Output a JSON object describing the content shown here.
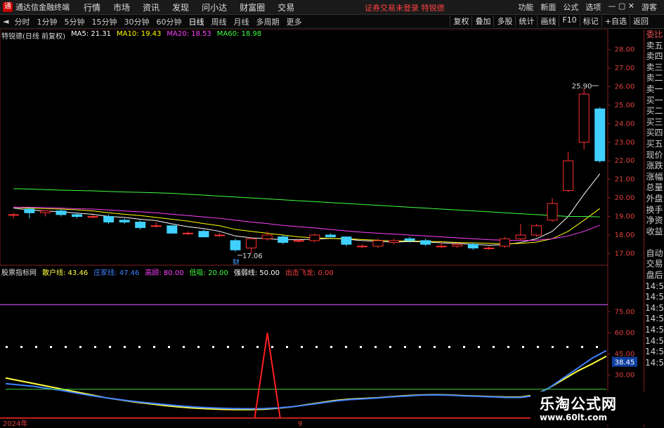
{
  "app": {
    "title": "通达信金融终端",
    "menu": [
      "行情",
      "市场",
      "资讯",
      "发现",
      "问小达",
      "财富圈",
      "交易"
    ],
    "login_warning": "证券交易未登录 特锐德",
    "right_menu": [
      "功能",
      "新面",
      "公式",
      "选项"
    ],
    "right_menu_extra": "游客"
  },
  "toolbar": {
    "periods": [
      "分时",
      "1分钟",
      "5分钟",
      "15分钟",
      "30分钟",
      "60分钟",
      "日线",
      "周线",
      "月线",
      "多周期",
      "更多"
    ],
    "active_period": "日线",
    "tools": [
      "复权",
      "叠加",
      "多股",
      "统计",
      "画线",
      "F10",
      "标记",
      "+自选",
      "返回"
    ]
  },
  "main_chart_info": {
    "stock": "特锐德(日线 前复权)",
    "ma5": "MA5: 21.31",
    "ma10": "MA10: 19.43",
    "ma20": "MA20: 18.53",
    "ma60": "MA60: 18.98",
    "colors": {
      "ma5": "#ffffff",
      "ma10": "#ffff00",
      "ma20": "#ff40ff",
      "ma60": "#40ff40"
    }
  },
  "indicator_info": {
    "name": "股票指标网",
    "items": [
      {
        "label": "散户线: 43.46",
        "color": "#ffff40"
      },
      {
        "label": "庄家线: 47.46",
        "color": "#4080ff"
      },
      {
        "label": "高顾: 80.00",
        "color": "#ff40ff"
      },
      {
        "label": "低吸: 20.00",
        "color": "#40ff40"
      },
      {
        "label": "强弱线: 50.00",
        "color": "#ffffff"
      },
      {
        "label": "出击飞龙: 0.00",
        "color": "#ff4040"
      }
    ]
  },
  "sidepanel": [
    {
      "text": "委比",
      "red": true
    },
    {
      "text": "卖五",
      "red": false
    },
    {
      "text": "卖四",
      "red": false
    },
    {
      "text": "卖三",
      "red": false
    },
    {
      "text": "卖二",
      "red": false
    },
    {
      "text": "卖一",
      "red": false
    },
    {
      "text": "买一",
      "red": false
    },
    {
      "text": "买二",
      "red": false
    },
    {
      "text": "买三",
      "red": false
    },
    {
      "text": "买四",
      "red": false
    },
    {
      "text": "买五",
      "red": false
    },
    {
      "text": "现价",
      "red": false
    },
    {
      "text": "涨跌",
      "red": false
    },
    {
      "text": "涨幅",
      "red": false
    },
    {
      "text": "总量",
      "red": false
    },
    {
      "text": "外盘",
      "red": false
    },
    {
      "text": "换手",
      "red": false
    },
    {
      "text": "净资",
      "red": false
    },
    {
      "text": "收益",
      "red": false
    },
    {
      "text": "",
      "red": false
    },
    {
      "text": "自动",
      "red": false
    },
    {
      "text": "交易",
      "red": false
    },
    {
      "text": "盘后",
      "red": false
    },
    {
      "text": "14:5",
      "red": false
    },
    {
      "text": "14:5",
      "red": false
    },
    {
      "text": "14:5",
      "red": false
    },
    {
      "text": "14:5",
      "red": false
    },
    {
      "text": "14:5",
      "red": false
    },
    {
      "text": "14:5",
      "red": false
    },
    {
      "text": "14:5",
      "red": false
    },
    {
      "text": "14:5",
      "red": false
    }
  ],
  "chart_data": [
    {
      "type": "candlestick",
      "y_ticks": [
        17.0,
        18.0,
        19.0,
        20.0,
        21.0,
        22.0,
        23.0,
        24.0,
        25.0,
        26.0,
        27.0,
        28.0
      ],
      "ylim": [
        16.6,
        28.4
      ],
      "annotations": [
        {
          "text": "25.90",
          "value": 25.9,
          "candle": 37
        },
        {
          "text": "17.06",
          "value": 17.06,
          "candle": 14
        },
        {
          "text": "财",
          "value": 16.7,
          "candle": 14
        }
      ],
      "candles": [
        [
          19.1,
          19.2,
          18.9,
          19.1
        ],
        [
          19.4,
          19.5,
          18.9,
          19.2
        ],
        [
          19.2,
          19.3,
          19.0,
          19.3
        ],
        [
          19.3,
          19.4,
          19.0,
          19.1
        ],
        [
          19.1,
          19.2,
          18.9,
          19.0
        ],
        [
          19.0,
          19.1,
          18.9,
          19.0
        ],
        [
          19.0,
          19.1,
          18.6,
          18.7
        ],
        [
          18.8,
          18.9,
          18.6,
          18.7
        ],
        [
          18.7,
          18.8,
          18.3,
          18.4
        ],
        [
          18.5,
          18.7,
          18.4,
          18.5
        ],
        [
          18.5,
          18.5,
          18.1,
          18.1
        ],
        [
          18.1,
          18.2,
          18.0,
          18.1
        ],
        [
          18.2,
          18.3,
          17.9,
          17.9
        ],
        [
          18.0,
          18.1,
          17.9,
          18.0
        ],
        [
          17.7,
          17.8,
          17.1,
          17.2
        ],
        [
          17.3,
          17.9,
          17.0,
          17.8
        ],
        [
          17.8,
          18.2,
          17.7,
          18.0
        ],
        [
          17.9,
          18.0,
          17.5,
          17.6
        ],
        [
          17.7,
          17.8,
          17.6,
          17.7
        ],
        [
          17.7,
          18.1,
          17.6,
          18.0
        ],
        [
          18.0,
          18.1,
          17.9,
          17.9
        ],
        [
          17.9,
          17.9,
          17.4,
          17.5
        ],
        [
          17.4,
          17.5,
          17.3,
          17.4
        ],
        [
          17.4,
          17.8,
          17.3,
          17.7
        ],
        [
          17.6,
          17.8,
          17.5,
          17.7
        ],
        [
          17.8,
          17.9,
          17.6,
          17.7
        ],
        [
          17.7,
          17.8,
          17.4,
          17.5
        ],
        [
          17.4,
          17.6,
          17.3,
          17.4
        ],
        [
          17.4,
          17.6,
          17.3,
          17.5
        ],
        [
          17.5,
          17.6,
          17.2,
          17.3
        ],
        [
          17.3,
          17.4,
          17.2,
          17.3
        ],
        [
          17.4,
          17.9,
          17.3,
          17.8
        ],
        [
          17.8,
          18.6,
          17.7,
          18.0
        ],
        [
          18.0,
          18.6,
          17.9,
          18.5
        ],
        [
          18.8,
          20.0,
          18.7,
          19.7
        ],
        [
          20.4,
          22.5,
          20.3,
          22.0
        ],
        [
          23.0,
          25.9,
          22.6,
          25.6
        ],
        [
          24.8,
          24.9,
          21.9,
          22.0
        ]
      ],
      "ma_series": [
        {
          "key": "ma5",
          "color": "#ffffff",
          "values": [
            19.45,
            19.35,
            19.3,
            19.25,
            19.18,
            19.12,
            19.0,
            18.95,
            18.85,
            18.78,
            18.6,
            18.45,
            18.35,
            18.2,
            17.95,
            17.85,
            17.8,
            17.75,
            17.75,
            17.78,
            17.82,
            17.78,
            17.7,
            17.66,
            17.62,
            17.65,
            17.63,
            17.58,
            17.55,
            17.5,
            17.45,
            17.48,
            17.6,
            17.8,
            18.2,
            19.0,
            20.2,
            21.3
          ]
        },
        {
          "key": "ma10",
          "color": "#ffff00",
          "values": [
            19.5,
            19.45,
            19.42,
            19.4,
            19.36,
            19.3,
            19.2,
            19.12,
            19.05,
            18.95,
            18.85,
            18.75,
            18.62,
            18.5,
            18.3,
            18.2,
            18.1,
            18.0,
            17.9,
            17.85,
            17.82,
            17.8,
            17.76,
            17.72,
            17.68,
            17.68,
            17.66,
            17.64,
            17.6,
            17.58,
            17.55,
            17.52,
            17.55,
            17.62,
            17.8,
            18.2,
            18.8,
            19.43
          ]
        },
        {
          "key": "ma20",
          "color": "#ff40ff",
          "values": [
            19.5,
            19.5,
            19.48,
            19.45,
            19.42,
            19.4,
            19.35,
            19.3,
            19.25,
            19.2,
            19.12,
            19.05,
            18.98,
            18.9,
            18.8,
            18.7,
            18.62,
            18.52,
            18.45,
            18.38,
            18.3,
            18.22,
            18.15,
            18.1,
            18.05,
            18.0,
            17.95,
            17.9,
            17.85,
            17.8,
            17.75,
            17.72,
            17.7,
            17.72,
            17.8,
            17.95,
            18.2,
            18.53
          ]
        },
        {
          "key": "ma60",
          "color": "#40ff40",
          "values": [
            20.5,
            20.48,
            20.45,
            20.42,
            20.4,
            20.38,
            20.35,
            20.32,
            20.3,
            20.28,
            20.25,
            20.2,
            20.15,
            20.1,
            20.05,
            20.0,
            19.95,
            19.9,
            19.85,
            19.8,
            19.75,
            19.7,
            19.65,
            19.6,
            19.55,
            19.5,
            19.45,
            19.4,
            19.35,
            19.3,
            19.25,
            19.2,
            19.15,
            19.1,
            19.05,
            19.0,
            19.0,
            18.98
          ]
        }
      ]
    },
    {
      "type": "line",
      "y_ticks": [
        30.0,
        45.0,
        60.0,
        75.0
      ],
      "ylim": [
        0,
        100
      ],
      "current_value_label": "38.45",
      "x_labels": [
        "2024年",
        "9"
      ],
      "series": [
        {
          "key": "retail",
          "color": "#ffff40",
          "values": [
            28,
            26,
            24,
            22,
            20,
            18,
            16,
            14,
            12.5,
            11,
            9.8,
            8.6,
            7.6,
            6.8,
            6.2,
            5.8,
            5.6,
            5.6,
            5.8,
            6.5,
            7.5,
            9,
            10.5,
            12,
            13,
            13.5,
            14,
            14.8,
            15.5,
            16,
            16.2,
            16,
            15.5,
            15.2,
            14.8,
            14.5,
            14.5,
            16,
            21,
            27,
            33,
            38,
            43.46
          ]
        },
        {
          "key": "banker",
          "color": "#4080ff",
          "values": [
            24,
            23,
            22,
            20.5,
            19,
            17.2,
            15.5,
            14,
            12.6,
            11.4,
            10.3,
            9.3,
            8.4,
            7.6,
            7,
            6.6,
            6.3,
            6.2,
            6.3,
            6.8,
            7.6,
            8.8,
            10.2,
            11.6,
            12.6,
            13.2,
            13.8,
            14.6,
            15.2,
            15.8,
            16,
            15.8,
            15.3,
            15,
            14.6,
            14.2,
            14.2,
            15.5,
            21,
            28,
            35,
            42,
            47.46
          ]
        },
        {
          "key": "strong_weak",
          "color": "#40d040",
          "values": [
            20,
            20,
            20,
            20,
            20,
            20,
            20,
            20,
            20,
            20,
            20,
            20,
            20,
            20,
            20,
            20,
            20,
            20,
            20,
            20,
            20,
            20,
            20,
            20,
            20,
            20,
            20,
            20,
            20,
            20,
            20,
            20,
            20,
            20,
            20,
            20,
            20,
            20,
            20,
            20,
            20,
            20,
            20
          ]
        }
      ],
      "high_line": 80,
      "dotted_line": 50,
      "spike": {
        "at": 18.3,
        "from": 0,
        "to": 60
      }
    }
  ],
  "watermark": {
    "line1": "乐淘公式网",
    "line2": "www.60lt.com"
  }
}
